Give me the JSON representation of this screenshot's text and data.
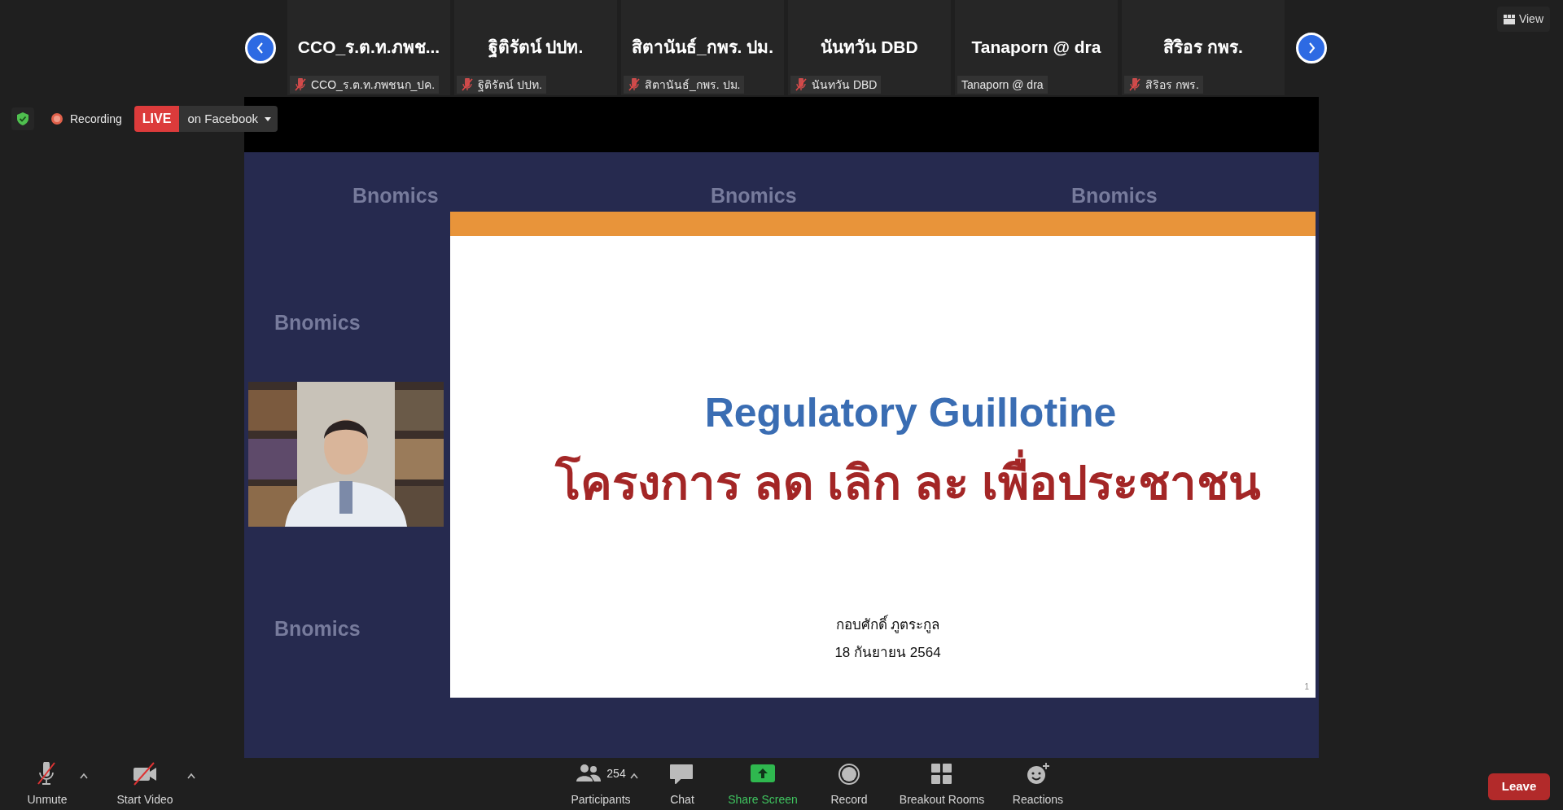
{
  "gallery": {
    "participants": [
      {
        "display_name": "CCO_ร.ต.ท.ภพช...",
        "name_tag": "CCO_ร.ต.ท.ภพชนก_ปค.",
        "muted": true
      },
      {
        "display_name": "ฐิติรัตน์ ปปท.",
        "name_tag": "ฐิติรัตน์ ปปท.",
        "muted": true
      },
      {
        "display_name": "สิตานันธ์_กพร. ปม.",
        "name_tag": "สิตานันธ์_กพร. ปม.",
        "muted": true
      },
      {
        "display_name": "นันทวัน DBD",
        "name_tag": "นันทวัน DBD",
        "muted": true
      },
      {
        "display_name": "Tanaporn @ dra",
        "name_tag": "Tanaporn @ dra",
        "muted": false
      },
      {
        "display_name": "สิริอร กพร.",
        "name_tag": "สิริอร กพร.",
        "muted": true
      }
    ]
  },
  "view_button": "View",
  "meeting_status": {
    "recording": "Recording",
    "live_badge": "LIVE",
    "live_target": "on Facebook"
  },
  "shared_screen": {
    "watermarks": [
      "Bnomics",
      "Bnomics",
      "Bnomics",
      "Bnomics",
      "Bnomics"
    ],
    "slide": {
      "title": "Regulatory Guillotine",
      "subtitle": "โครงการ ลด เลิก ละ เพื่อประชาชน",
      "author": "กอบศักดิ์ ภูตระกูล",
      "date": "18 กันยายน 2564",
      "page_number": "1"
    }
  },
  "toolbar": {
    "left": [
      {
        "kind": "mic",
        "label": "Unmute"
      },
      {
        "kind": "video",
        "label": "Start Video"
      }
    ],
    "center": [
      {
        "kind": "participants",
        "label": "Participants",
        "count": "254"
      },
      {
        "kind": "chat",
        "label": "Chat"
      },
      {
        "kind": "share",
        "label": "Share Screen"
      },
      {
        "kind": "record",
        "label": "Record"
      },
      {
        "kind": "breakout",
        "label": "Breakout Rooms"
      },
      {
        "kind": "reactions",
        "label": "Reactions"
      }
    ],
    "leave": "Leave"
  }
}
